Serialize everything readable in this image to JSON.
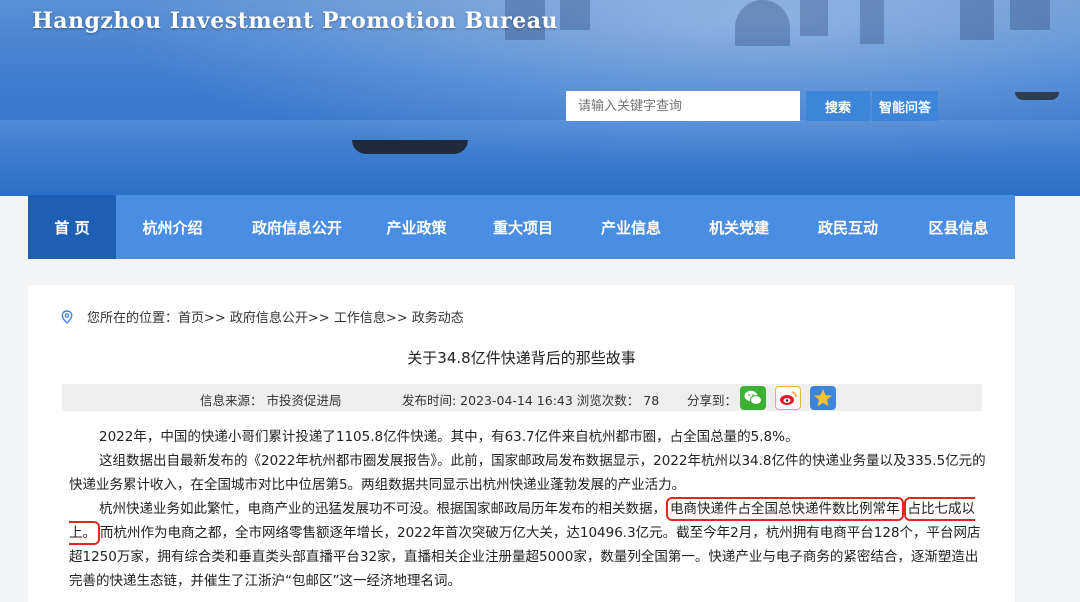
{
  "site": {
    "title": "Hangzhou Investment Promotion Bureau"
  },
  "search": {
    "placeholder": "请输入关键字查询",
    "button": "搜索",
    "qa_button": "智能问答"
  },
  "nav": {
    "items": [
      {
        "label": "首 页",
        "active": true
      },
      {
        "label": "杭州介绍"
      },
      {
        "label": "政府信息公开"
      },
      {
        "label": "产业政策"
      },
      {
        "label": "重大项目"
      },
      {
        "label": "产业信息"
      },
      {
        "label": "机关党建"
      },
      {
        "label": "政民互动"
      },
      {
        "label": "区县信息"
      }
    ]
  },
  "breadcrumb": {
    "text": "您所在的位置：首页>> 政府信息公开>> 工作信息>> 政务动态"
  },
  "article": {
    "title": "关于34.8亿件快递背后的那些故事",
    "source": "信息来源：  市投资促进局",
    "published": "发布时间: 2023-04-14 16:43 浏览次数：  78",
    "share_label": "分享到：",
    "p1": "2022年，中国的快递小哥们累计投递了1105.8亿件快递。其中，有63.7亿件来自杭州都市圈，占全国总量的5.8%。",
    "p2": "这组数据出自最新发布的《2022年杭州都市圈发展报告》。此前，国家邮政局发布数据显示，2022年杭州以34.8亿件的快递业务量以及335.5亿元的快递业务累计收入，在全国城市对比中位居第5。两组数据共同显示出杭州快递业蓬勃发展的产业活力。",
    "p3_a": "杭州快递业务如此繁忙，电商产业的迅猛发展功不可没。根据国家邮政局历年发布的相关数据，",
    "p3_hl1": "电商快递件占全国总快递件数比例常年",
    "p3_hl2": "占比七成以上。",
    "p3_b": "而杭州作为电商之都，全市网络零售额逐年增长，2022年首次突破万亿大关，达10496.3亿元。截至今年2月，杭州拥有电商平台128个，平台网店超1250万家，拥有综合类和垂直类头部直播平台32家，直播相关企业注册量超5000家，数量列全国第一。快递产业与电子商务的紧密结合，逐渐塑造出完善的快递生态链，并催生了江浙沪“包邮区”这一经济地理名词。"
  },
  "colors": {
    "nav": "#4a8ee3",
    "nav_active": "#1e5fb4",
    "highlight": "#e0281f",
    "search_btn": "#3d85d8"
  },
  "icons": [
    "location-pin-icon",
    "wechat-icon",
    "weibo-icon",
    "qzone-icon"
  ]
}
